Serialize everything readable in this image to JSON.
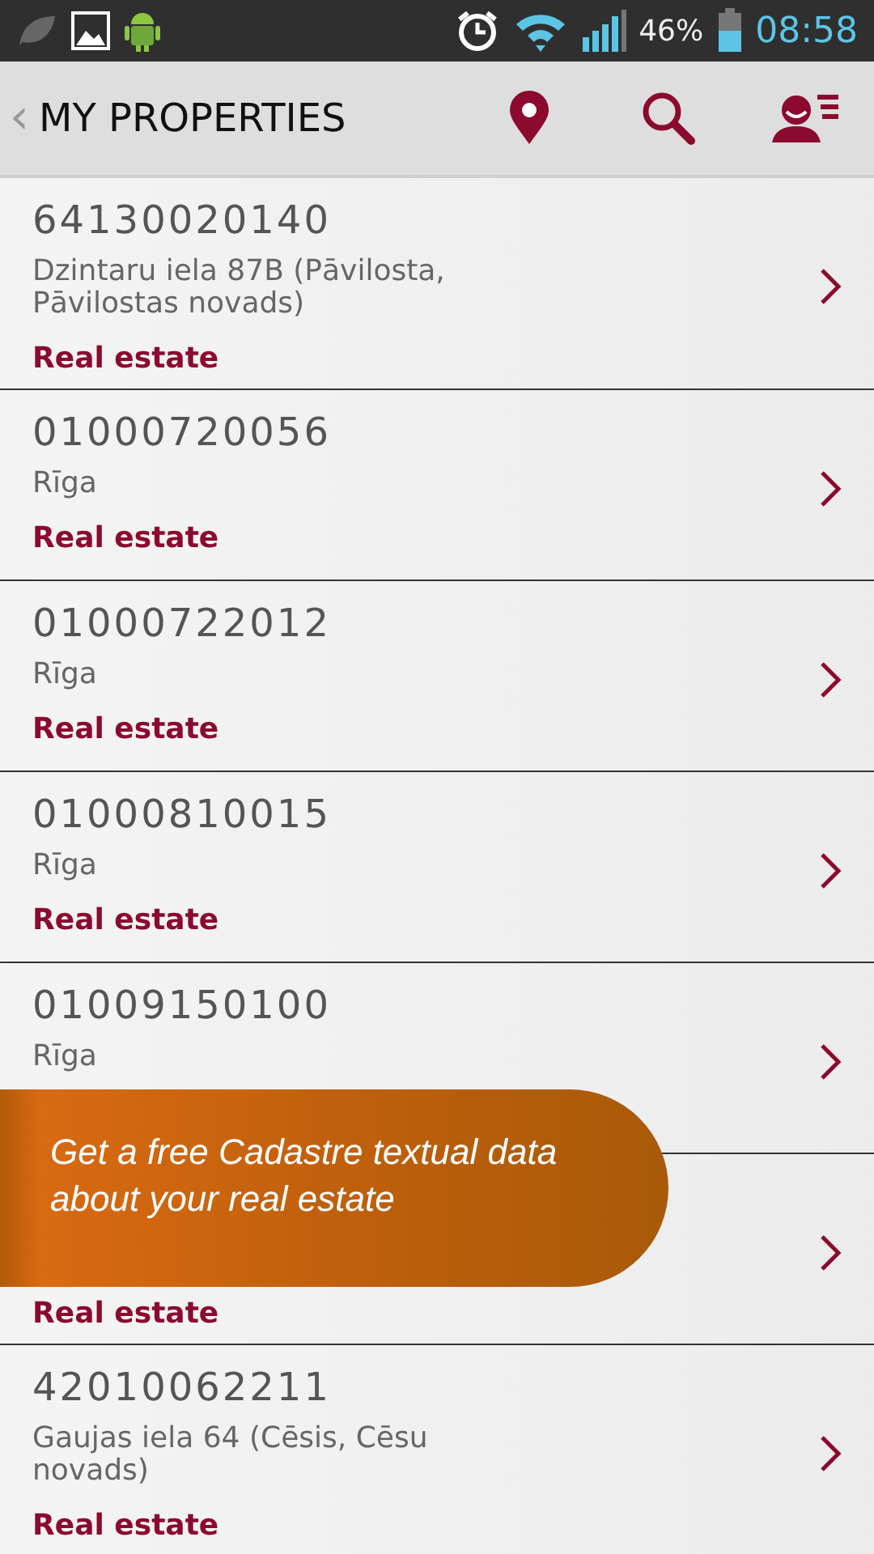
{
  "status_bar": {
    "battery": "46%",
    "time": "08:58"
  },
  "header": {
    "back": "‹",
    "title": "MY PROPERTIES"
  },
  "properties": [
    {
      "number": "64130020140",
      "address": "Dzintaru iela 87B (Pāvilosta, Pāvilostas novads)",
      "type": "Real estate"
    },
    {
      "number": "01000720056",
      "address": "Rīga",
      "type": "Real estate"
    },
    {
      "number": "01000722012",
      "address": "Rīga",
      "type": "Real estate"
    },
    {
      "number": "01000810015",
      "address": "Rīga",
      "type": "Real estate"
    },
    {
      "number": "01009150100",
      "address": "Rīga"
    },
    {
      "type": "Real estate"
    },
    {
      "number": "42010062211",
      "address": "Gaujas iela 64 (Cēsis, Cēsu novads)",
      "type": "Real estate"
    }
  ],
  "promo_banner": {
    "text": "Get a free Cadastre textual data about your real estate"
  }
}
